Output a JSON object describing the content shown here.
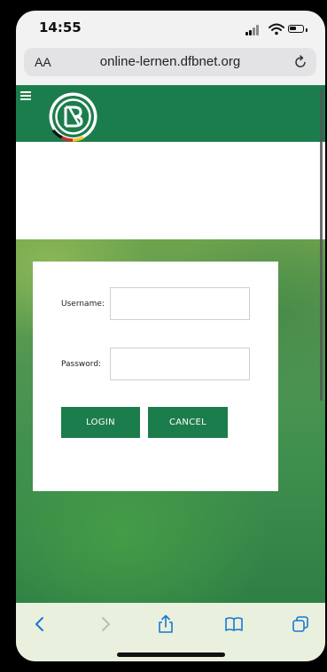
{
  "status_bar": {
    "time": "14:55"
  },
  "address_bar": {
    "text_size_label": "AA",
    "url": "online-lernen.dfbnet.org"
  },
  "login_form": {
    "username_label": "Username:",
    "username_value": "",
    "password_label": "Password:",
    "password_value": "",
    "login_label": "LOGIN",
    "cancel_label": "CANCEL"
  },
  "colors": {
    "brand_green": "#1c7d4c",
    "toolbar_bg": "#e9f0de",
    "accent_blue": "#1877d2"
  },
  "toolbar": {
    "icons": [
      "back-icon",
      "forward-icon",
      "share-icon",
      "bookmarks-icon",
      "tabs-icon"
    ]
  }
}
